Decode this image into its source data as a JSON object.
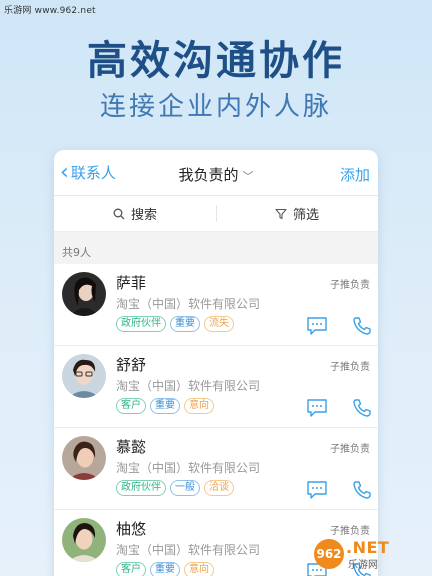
{
  "watermark_top": "乐游网 www.962.net",
  "headline": "高效沟通协作",
  "subline": "连接企业内外人脉",
  "navbar": {
    "back_label": "联系人",
    "title": "我负责的",
    "add_label": "添加"
  },
  "toolbar": {
    "search_label": "搜索",
    "filter_label": "筛选"
  },
  "count_label": "共9人",
  "contacts": [
    {
      "name": "萨菲",
      "owner": "子推负责",
      "company": "淘宝（中国）软件有限公司",
      "tags": [
        "政府伙伴",
        "重要",
        "流失"
      ]
    },
    {
      "name": "舒舒",
      "owner": "子推负责",
      "company": "淘宝（中国）软件有限公司",
      "tags": [
        "客户",
        "重要",
        "意向"
      ]
    },
    {
      "name": "慕懿",
      "owner": "子推负责",
      "company": "淘宝（中国）软件有限公司",
      "tags": [
        "政府伙伴",
        "一般",
        "洽谈"
      ]
    },
    {
      "name": "柚悠",
      "owner": "子推负责",
      "company": "淘宝（中国）软件有限公司",
      "tags": [
        "客户",
        "重要",
        "意向"
      ]
    }
  ],
  "watermark_bottom": {
    "number": "962",
    "brand": ".NET",
    "brand_sub": "乐游网"
  },
  "colors": {
    "accent": "#3aa0e8",
    "tag_green": "#2fb48a",
    "tag_blue": "#3a8ed6",
    "tag_orange": "#f0a24a",
    "headline": "#1e4f86"
  }
}
